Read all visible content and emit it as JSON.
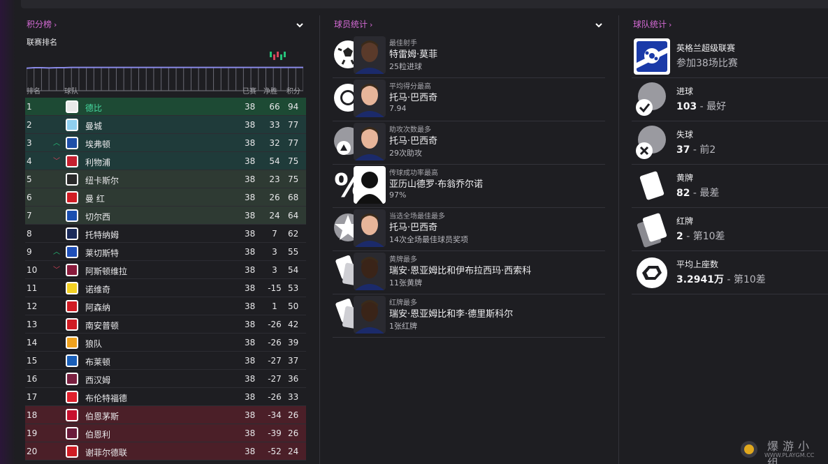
{
  "league": {
    "title": "积分榜",
    "chevron": "›",
    "subtitle": "联赛排名",
    "headers": {
      "pos": "排名",
      "team": "球队",
      "played": "已赛",
      "gd": "净胜",
      "pts": "积分"
    },
    "rows": [
      {
        "pos": "1",
        "move": "",
        "team": "德比",
        "played": "38",
        "gd": "66",
        "pts": "94",
        "bg": "#1d4a34",
        "badge": "#e9e9e9",
        "highlight": true
      },
      {
        "pos": "2",
        "move": "",
        "team": "曼城",
        "played": "38",
        "gd": "33",
        "pts": "77",
        "bg": "#1f3b3a",
        "badge": "#8fd0f0"
      },
      {
        "pos": "3",
        "move": "^",
        "team": "埃弗顿",
        "played": "38",
        "gd": "32",
        "pts": "77",
        "bg": "#1f3b3a",
        "badge": "#1e4fa8"
      },
      {
        "pos": "4",
        "move": "v",
        "team": "利物浦",
        "played": "38",
        "gd": "54",
        "pts": "75",
        "bg": "#1f3b3a",
        "badge": "#c42030"
      },
      {
        "pos": "5",
        "move": "",
        "team": "纽卡斯尔",
        "played": "38",
        "gd": "23",
        "pts": "75",
        "bg": "#2e3a33",
        "badge": "#2a2a2a"
      },
      {
        "pos": "6",
        "move": "",
        "team": "曼 红",
        "played": "38",
        "gd": "26",
        "pts": "68",
        "bg": "#2e3a33",
        "badge": "#d01c24"
      },
      {
        "pos": "7",
        "move": "",
        "team": "切尔西",
        "played": "38",
        "gd": "24",
        "pts": "64",
        "bg": "#2e3a33",
        "badge": "#1a4fb0"
      },
      {
        "pos": "8",
        "move": "",
        "team": "托特纳姆",
        "played": "38",
        "gd": "7",
        "pts": "62",
        "bg": "#1e1e22",
        "badge": "#1a2a5a"
      },
      {
        "pos": "9",
        "move": "^",
        "team": "莱切斯特",
        "played": "38",
        "gd": "3",
        "pts": "55",
        "bg": "#1e1e22",
        "badge": "#1f4fb8"
      },
      {
        "pos": "10",
        "move": "v",
        "team": "阿斯顿维拉",
        "played": "38",
        "gd": "3",
        "pts": "54",
        "bg": "#1e1e22",
        "badge": "#8a1b3c"
      },
      {
        "pos": "11",
        "move": "",
        "team": "诺维奇",
        "played": "38",
        "gd": "-15",
        "pts": "53",
        "bg": "#1e1e22",
        "badge": "#f2d023"
      },
      {
        "pos": "12",
        "move": "",
        "team": "阿森纳",
        "played": "38",
        "gd": "1",
        "pts": "50",
        "bg": "#1e1e22",
        "badge": "#d01c24"
      },
      {
        "pos": "13",
        "move": "",
        "team": "南安普顿",
        "played": "38",
        "gd": "-26",
        "pts": "42",
        "bg": "#1e1e22",
        "badge": "#d01c24"
      },
      {
        "pos": "14",
        "move": "",
        "team": "狼队",
        "played": "38",
        "gd": "-26",
        "pts": "39",
        "bg": "#1e1e22",
        "badge": "#f0a21e"
      },
      {
        "pos": "15",
        "move": "",
        "team": "布莱顿",
        "played": "38",
        "gd": "-27",
        "pts": "37",
        "bg": "#1e1e22",
        "badge": "#1a5fb8"
      },
      {
        "pos": "16",
        "move": "",
        "team": "西汉姆",
        "played": "38",
        "gd": "-27",
        "pts": "36",
        "bg": "#1e1e22",
        "badge": "#7a2040"
      },
      {
        "pos": "17",
        "move": "",
        "team": "布伦特福德",
        "played": "38",
        "gd": "-26",
        "pts": "33",
        "bg": "#1e1e22",
        "badge": "#e0202c"
      },
      {
        "pos": "18",
        "move": "",
        "team": "伯恩茅斯",
        "played": "38",
        "gd": "-34",
        "pts": "26",
        "bg": "#4b1f28",
        "badge": "#c8102e"
      },
      {
        "pos": "19",
        "move": "",
        "team": "伯恩利",
        "played": "38",
        "gd": "-39",
        "pts": "26",
        "bg": "#4b1f28",
        "badge": "#6a1a3a"
      },
      {
        "pos": "20",
        "move": "",
        "team": "谢菲尔德联",
        "played": "38",
        "gd": "-52",
        "pts": "24",
        "bg": "#4b1f28",
        "badge": "#d01c24"
      }
    ],
    "trend": [
      0.95,
      0.97,
      0.97,
      0.96,
      0.97,
      0.97,
      0.98,
      0.98,
      0.98,
      0.98,
      0.98,
      0.98,
      0.98,
      0.98,
      0.98,
      0.98,
      0.98,
      0.98,
      0.98,
      0.98,
      0.98,
      0.98,
      0.98,
      0.98,
      0.98,
      0.98,
      0.98,
      0.98,
      0.98,
      0.98,
      0.98,
      0.98,
      0.98,
      0.98,
      0.98,
      0.98,
      0.98,
      0.98
    ]
  },
  "players": {
    "title": "球员统计",
    "chevron": "›",
    "items": [
      {
        "category": "最佳射手",
        "name": "特雷姆·莫菲",
        "value": "25粒进球",
        "icon": "football-icon",
        "skin": "#5a3a2a"
      },
      {
        "category": "平均得分最高",
        "name": "托马·巴西奇",
        "value": "7.94",
        "icon": "rosette-icon",
        "skin": "#e7b59a"
      },
      {
        "category": "助攻次数最多",
        "name": "托马·巴西奇",
        "value": "29次助攻",
        "icon": "assist-icon",
        "skin": "#e7b59a"
      },
      {
        "category": "传球成功率最高",
        "name": "亚历山德罗·布翁乔尔诺",
        "value": "97%",
        "icon": "percent-icon",
        "skin": "silhouette"
      },
      {
        "category": "当选全场最佳最多",
        "name": "托马·巴西奇",
        "value": "14次全场最佳球员奖项",
        "icon": "star-icon",
        "skin": "#e7b59a"
      },
      {
        "category": "黄牌最多",
        "name": "瑞安·恩亚姆比和伊布拉西玛·西索科",
        "value": "11张黄牌",
        "icon": "yellow-card-icon",
        "skin": "#3a2418"
      },
      {
        "category": "红牌最多",
        "name": "瑞安·恩亚姆比和李·德里斯科尔",
        "value": "1张红牌",
        "icon": "red-card-icon",
        "skin": "#3a2418"
      }
    ]
  },
  "team": {
    "title": "球队统计",
    "chevron": "›",
    "league": {
      "name": "英格兰超级联赛",
      "sub": "参加38场比赛"
    },
    "stats": [
      {
        "label": "进球",
        "value": "103",
        "rank": " - 最好",
        "icon": "goals-check-icon"
      },
      {
        "label": "失球",
        "value": "37",
        "rank": " - 前2",
        "icon": "conceded-x-icon"
      },
      {
        "label": "黄牌",
        "value": "82",
        "rank": " - 最差",
        "icon": "yellow-cards-icon"
      },
      {
        "label": "红牌",
        "value": "2",
        "rank": " - 第10差",
        "icon": "red-cards-icon"
      },
      {
        "label": "平均上座数",
        "value": "3.2941万",
        "rank": " - 第10差",
        "icon": "attendance-icon"
      }
    ]
  },
  "watermark": {
    "text": "爆游小组",
    "url": "WWW.PLAYGM.CC"
  }
}
